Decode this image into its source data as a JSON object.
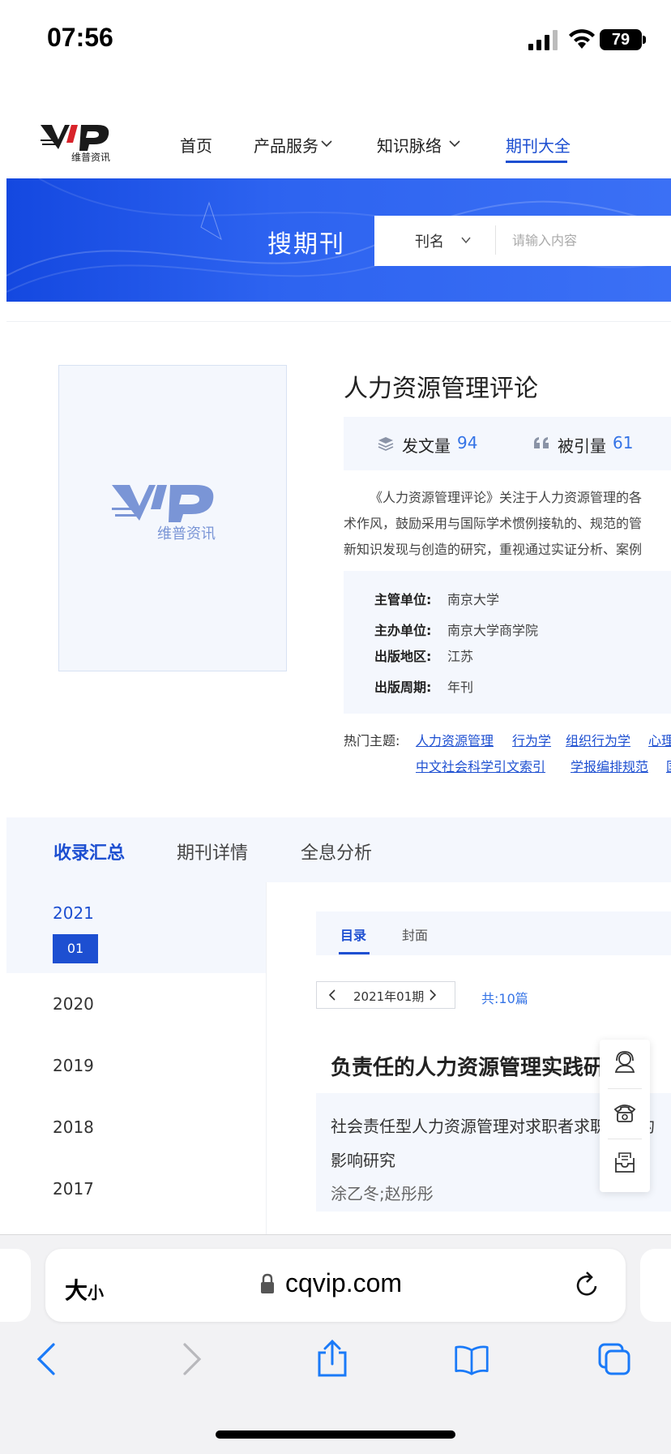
{
  "status_bar": {
    "time": "07:56",
    "battery": "79"
  },
  "nav": {
    "items": [
      {
        "label": "首页"
      },
      {
        "label": "产品服务"
      },
      {
        "label": "知识脉络"
      },
      {
        "label": "期刊大全"
      }
    ],
    "active_index": 3,
    "logo_text": "维普资讯"
  },
  "banner": {
    "title": "搜期刊",
    "search_field": "刊名",
    "search_placeholder": "请输入内容"
  },
  "journal": {
    "title": "人力资源管理评论",
    "cover_logo_text": "维普资讯",
    "stats": {
      "papers_label": "发文量",
      "papers_value": "94",
      "citations_label": "被引量",
      "citations_value": "61"
    },
    "description_lines": [
      "《人力资源管理评论》关注于人力资源管理的各",
      "术作风，鼓励采用与国际学术惯例接轨的、规范的管",
      "新知识发现与创造的研究，重视通过实证分析、案例"
    ],
    "meta": [
      {
        "label": "主管单位:",
        "value": "南京大学"
      },
      {
        "label": "主办单位:",
        "value": "南京大学商学院"
      },
      {
        "label": "出版地区:",
        "value": "江苏"
      },
      {
        "label": "出版周期:",
        "value": "年刊"
      }
    ],
    "hot_topics_label": "热门主题:",
    "hot_topics_row1": [
      "人力资源管理",
      "行为学",
      "组织行为学",
      "心理"
    ],
    "hot_topics_row2": [
      "中文社会科学引文索引",
      "学报编排规范",
      "国"
    ]
  },
  "tabs": [
    {
      "label": "收录汇总"
    },
    {
      "label": "期刊详情"
    },
    {
      "label": "全息分析"
    }
  ],
  "years": [
    "2021",
    "2020",
    "2019",
    "2018",
    "2017"
  ],
  "active_issue": "01",
  "subtabs": [
    {
      "label": "目录"
    },
    {
      "label": "封面"
    }
  ],
  "issue_nav": {
    "current": "2021年01期",
    "count": "共:10篇"
  },
  "section_title": "负责任的人力资源管理实践研究",
  "article": {
    "title": "社会责任型人力资源管理对求职者求职意愿的影响研究",
    "authors": "涂乙冬;赵彤彤"
  },
  "safari": {
    "text_size_big": "大",
    "text_size_small": "小",
    "url": "cqvip.com"
  },
  "colors": {
    "accent": "#1d4fd1",
    "banner": "#2d63f0",
    "panel_bg": "#f4f7fd",
    "link": "#3473e6"
  }
}
